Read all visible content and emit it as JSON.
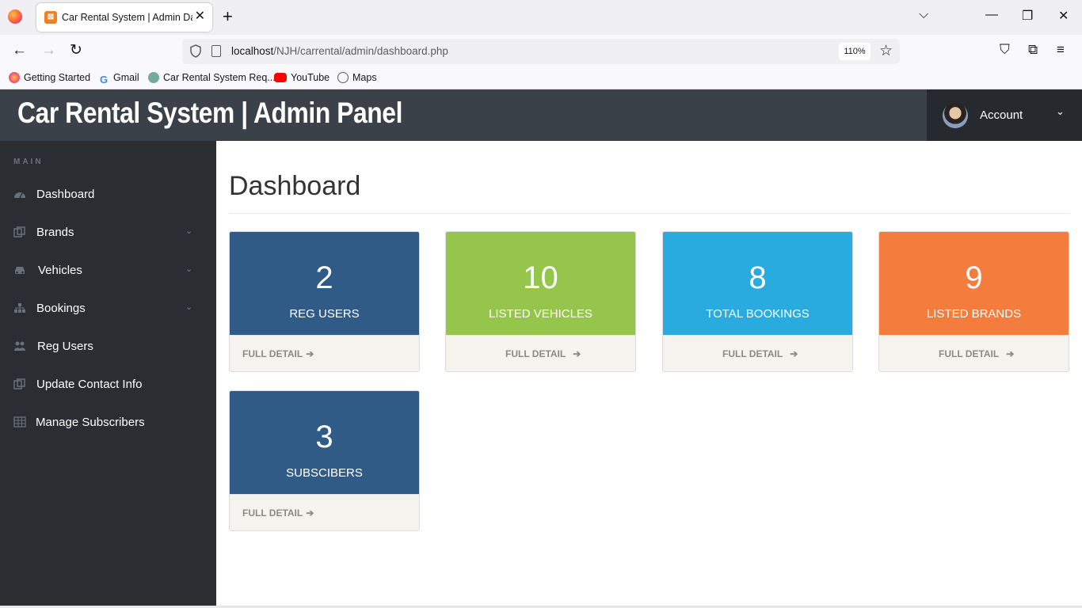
{
  "browser": {
    "tab_title": "Car Rental System | Admin Dasl",
    "url_host": "localhost",
    "url_path": "/NJH/carrental/admin/dashboard.php",
    "zoom": "110%",
    "bookmarks": [
      {
        "label": "Getting Started"
      },
      {
        "label": "Gmail"
      },
      {
        "label": "Car Rental System Req..."
      },
      {
        "label": "YouTube"
      },
      {
        "label": "Maps"
      }
    ]
  },
  "header": {
    "title": "Car Rental System | Admin Panel",
    "account_label": "Account"
  },
  "sidebar": {
    "heading": "MAIN",
    "items": [
      {
        "label": "Dashboard",
        "icon": "dashboard-icon",
        "has_caret": false
      },
      {
        "label": "Brands",
        "icon": "copy-icon",
        "has_caret": true
      },
      {
        "label": "Vehicles",
        "icon": "car-icon",
        "has_caret": true
      },
      {
        "label": "Bookings",
        "icon": "sitemap-icon",
        "has_caret": true
      },
      {
        "label": "Reg Users",
        "icon": "users-icon",
        "has_caret": false
      },
      {
        "label": "Update Contact Info",
        "icon": "copy-icon",
        "has_caret": false
      },
      {
        "label": "Manage Subscribers",
        "icon": "table-icon",
        "has_caret": false
      }
    ]
  },
  "main": {
    "page_title": "Dashboard",
    "cards": [
      {
        "value": "2",
        "label": "REG USERS",
        "link": "FULL DETAIL",
        "color": "#315b87"
      },
      {
        "value": "10",
        "label": "LISTED VEHICLES",
        "link": "FULL DETAIL",
        "color": "#95c64b"
      },
      {
        "value": "8",
        "label": "TOTAL BOOKINGS",
        "link": "FULL DETAIL",
        "color": "#2aabe0"
      },
      {
        "value": "9",
        "label": "LISTED BRANDS",
        "link": "FULL DETAIL",
        "color": "#f47c3c"
      },
      {
        "value": "3",
        "label": "SUBSCIBERS",
        "link": "FULL DETAIL",
        "color": "#315b87"
      }
    ]
  },
  "colors": {
    "header_bg": "#3b4148",
    "sidebar_bg": "#2a2e33",
    "account_bg": "#262a2e"
  }
}
